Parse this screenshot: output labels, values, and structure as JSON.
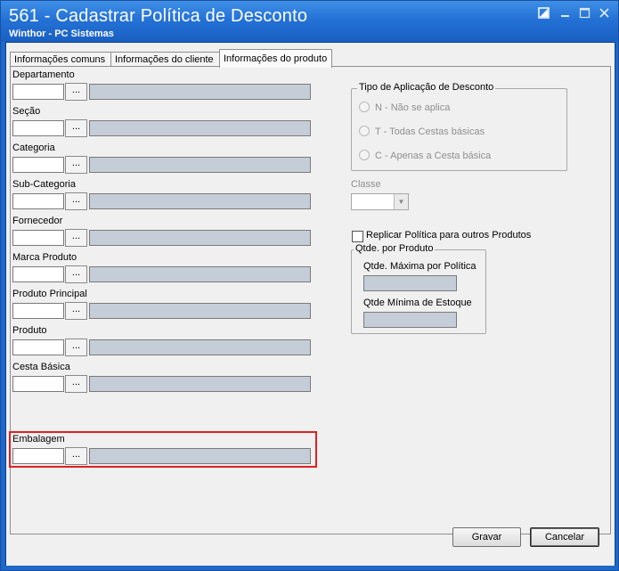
{
  "window": {
    "title": "561 - Cadastrar Política de Desconto",
    "subtitle": "Winthor - PC Sistemas"
  },
  "tabs": [
    {
      "label": "Informações comuns",
      "active": false
    },
    {
      "label": "Informações do cliente",
      "active": false
    },
    {
      "label": "Informações do produto",
      "active": true
    }
  ],
  "fields": [
    {
      "label": "Departamento",
      "code": "",
      "description": ""
    },
    {
      "label": "Seção",
      "code": "",
      "description": ""
    },
    {
      "label": "Categoria",
      "code": "",
      "description": ""
    },
    {
      "label": "Sub-Categoria",
      "code": "",
      "description": ""
    },
    {
      "label": "Fornecedor",
      "code": "",
      "description": ""
    },
    {
      "label": "Marca Produto",
      "code": "",
      "description": ""
    },
    {
      "label": "Produto Principal",
      "code": "",
      "description": ""
    },
    {
      "label": "Produto",
      "code": "",
      "description": ""
    },
    {
      "label": "Cesta Básica",
      "code": "",
      "description": ""
    },
    {
      "label": "Embalagem",
      "code": "",
      "description": ""
    }
  ],
  "lookup_button_label": "...",
  "discount_type": {
    "legend": "Tipo de Aplicação de Desconto",
    "options": [
      "N - Não se aplica",
      "T - Todas Cestas básicas",
      "C - Apenas a Cesta básica"
    ]
  },
  "classe": {
    "label": "Classe",
    "value": ""
  },
  "replicate": {
    "label": "Replicar Política para outros Produtos",
    "checked": false
  },
  "qtde_group": {
    "legend": "Qtde. por Produto",
    "max_label": "Qtde. Máxima por Política",
    "max_value": "",
    "min_label": "Qtde Mínima de Estoque",
    "min_value": ""
  },
  "buttons": {
    "save": "Gravar",
    "cancel": "Cancelar"
  },
  "colors": {
    "titlebar": "#2472d6",
    "highlight": "#e02020",
    "readonly_field": "#c5cdd8"
  }
}
